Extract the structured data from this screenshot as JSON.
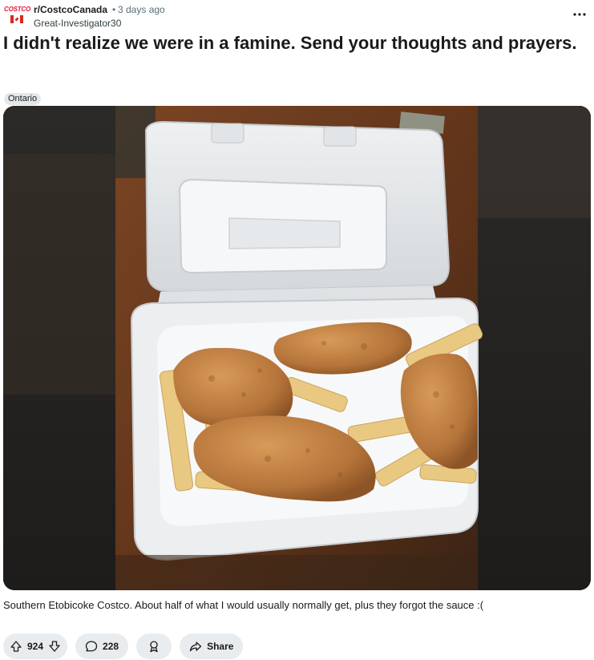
{
  "post": {
    "subreddit": "r/CostcoCanada",
    "separator": "•",
    "time_ago": "3 days ago",
    "author": "Great-Investigator30",
    "avatar_text": "COSTCO",
    "title": "I didn't realize we were in a famine. Send your thoughts and prayers.",
    "flair": "Ontario",
    "caption": "Southern Etobicoke Costco. About half of what I would usually normally get, plus they forgot the sauce :("
  },
  "actions": {
    "upvotes": "924",
    "comments": "228",
    "share_label": "Share"
  },
  "icons": {
    "more": "more-options-icon",
    "upvote": "upvote-icon",
    "downvote": "downvote-icon",
    "comment": "comment-icon",
    "award": "award-icon",
    "share": "share-icon"
  },
  "colors": {
    "pill_bg": "#e8ecee",
    "flair_bg": "#e4e8ea",
    "brand_red": "#e31837"
  }
}
